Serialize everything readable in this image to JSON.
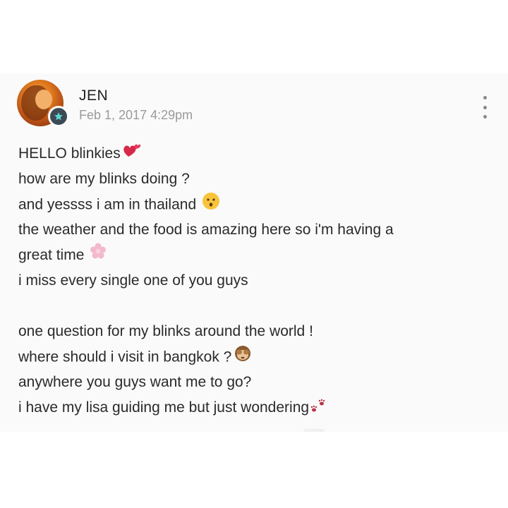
{
  "post": {
    "author": "JEN",
    "timestamp": "Feb 1, 2017 4:29pm",
    "lines": [
      "HELLO blinkies",
      "how are my blinks doing ?",
      "and yessss i am in thailand",
      "the weather and the food is amazing here so i'm having a",
      "great time",
      "i miss every single one of you guys",
      "",
      "one question for my blinks around the world !",
      "where should i visit in bangkok ?",
      "anywhere you guys want me to go?",
      "i have my lisa guiding me but just wondering"
    ],
    "emojis": {
      "line1": "two-hearts-icon",
      "line3": "kissing-face-icon",
      "line5": "cherry-blossom-icon",
      "line9": "see-no-evil-monkey-icon",
      "line11": "paw-prints-icon"
    }
  },
  "colors": {
    "card_background": "#fafafa",
    "author_text": "#222222",
    "timestamp_text": "#9a9a9a",
    "body_text": "#2a2a2a",
    "badge": "#3b4a55"
  }
}
